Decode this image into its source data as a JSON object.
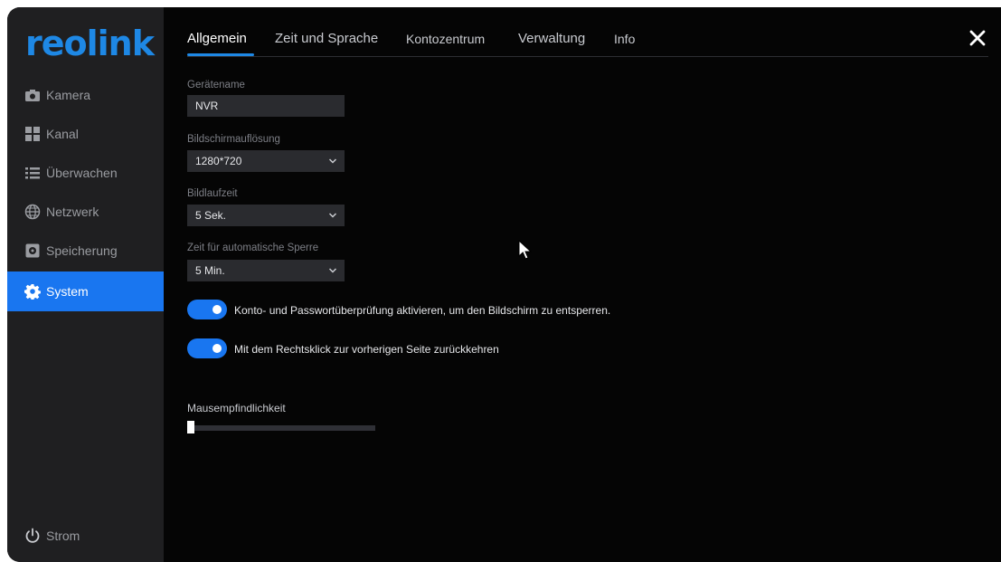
{
  "brand": {
    "logo_text": "reolink",
    "accent_color": "#1976f0"
  },
  "sidebar": {
    "items": [
      {
        "label": "Kamera",
        "icon": "camera-icon",
        "active": false
      },
      {
        "label": "Kanal",
        "icon": "grid-icon",
        "active": false
      },
      {
        "label": "Überwachen",
        "icon": "list-icon",
        "active": false
      },
      {
        "label": "Netzwerk",
        "icon": "globe-icon",
        "active": false
      },
      {
        "label": "Speicherung",
        "icon": "storage-icon",
        "active": false
      },
      {
        "label": "System",
        "icon": "gear-icon",
        "active": true
      }
    ],
    "power": {
      "label": "Strom",
      "icon": "power-icon"
    }
  },
  "tabs": [
    {
      "label": "Allgemein",
      "active": true
    },
    {
      "label": "Zeit und Sprache",
      "active": false
    },
    {
      "label": "Kontozentrum",
      "active": false
    },
    {
      "label": "Verwaltung",
      "active": false
    },
    {
      "label": "Info",
      "active": false
    }
  ],
  "close_icon": "close-icon",
  "form": {
    "device_name": {
      "label": "Gerätename",
      "value": "NVR"
    },
    "resolution": {
      "label": "Bildschirmauflösung",
      "value": "1280*720"
    },
    "scroll_time": {
      "label": "Bildlaufzeit",
      "value": "5 Sek."
    },
    "auto_lock": {
      "label": "Zeit für automatische Sperre",
      "value": "5 Min."
    }
  },
  "toggles": [
    {
      "label": "Konto- und Passwortüberprüfung aktivieren, um den Bildschirm zu entsperren.",
      "on": true
    },
    {
      "label": "Mit dem Rechtsklick zur vorherigen Seite zurückkehren",
      "on": true
    }
  ],
  "mouse_sensitivity": {
    "label": "Mausempfindlichkeit",
    "level": 0
  }
}
